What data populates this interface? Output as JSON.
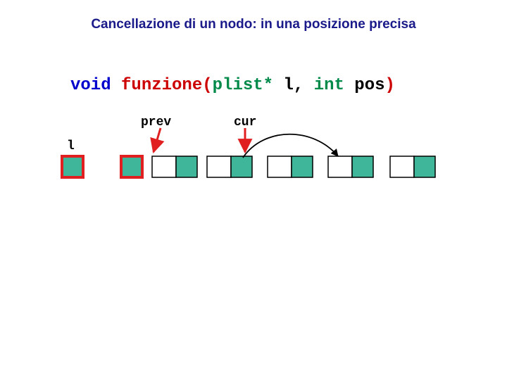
{
  "title": "Cancellazione di un nodo: in una posizione precisa",
  "signature": {
    "kw_void": "void",
    "fn_name": "funzione",
    "open": "(",
    "type1": "plist*",
    "arg1": " l",
    "comma": ", ",
    "type2": "int",
    "arg2": " pos",
    "close": ")"
  },
  "labels": {
    "l": "l",
    "prev": "prev",
    "cur": "cur"
  },
  "colors": {
    "teal": "#3fb69a",
    "red": "#e02020",
    "blue": "#1a1a8a"
  }
}
